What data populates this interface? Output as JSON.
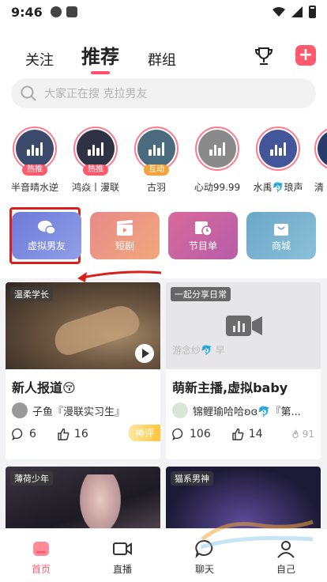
{
  "status_bar": {
    "time": "9:46"
  },
  "header": {
    "tabs": [
      {
        "label": "关注"
      },
      {
        "label": "推荐",
        "active": true
      },
      {
        "label": "群组"
      }
    ],
    "add_icon": "+"
  },
  "search": {
    "placeholder": "大家正在搜 克拉男友"
  },
  "live_strip": [
    {
      "name": "半音晴水逆",
      "badge": "热推",
      "color": "#3c4b6b"
    },
    {
      "name": "鸿焱丨漫联",
      "badge": "热推",
      "color": "#2f3145"
    },
    {
      "name": "古羽",
      "badge": "互动",
      "color": "#4a6a7d"
    },
    {
      "name": "心动99.99",
      "badge": "",
      "color": "#8a8a8a"
    },
    {
      "name": "水禹🐬琅声",
      "badge": "",
      "color": "#43569a"
    },
    {
      "name": "清",
      "badge": "",
      "color": "#2a3a6a"
    }
  ],
  "features": [
    {
      "label": "虚拟男友",
      "icon": "chat-bubbles-icon"
    },
    {
      "label": "短剧",
      "icon": "clapperboard-icon"
    },
    {
      "label": "节目单",
      "icon": "calendar-icon"
    },
    {
      "label": "商城",
      "icon": "shopping-bag-icon"
    }
  ],
  "cards": [
    {
      "tag": "温柔学长",
      "title": "新人报道😚",
      "author": "子鱼『漫联实习生』",
      "comments": "6",
      "likes": "16",
      "badge": "神评"
    },
    {
      "tag": "一起分享日常",
      "overlay_text": "游念纱🐬 早",
      "title": "萌新主播,虚拟baby",
      "author": "锦鲤瑜哈哈ʚɞ🐬『第...",
      "comments": "106",
      "likes": "14",
      "heat": "91"
    },
    {
      "tag": "薄荷少年"
    },
    {
      "tag": "猫系男神"
    }
  ],
  "bottom_nav": [
    {
      "label": "首页",
      "active": true
    },
    {
      "label": "直播"
    },
    {
      "label": "聊天"
    },
    {
      "label": "自己"
    }
  ],
  "colors": {
    "accent": "#ff5a6e",
    "highlight": "#d8211b"
  }
}
